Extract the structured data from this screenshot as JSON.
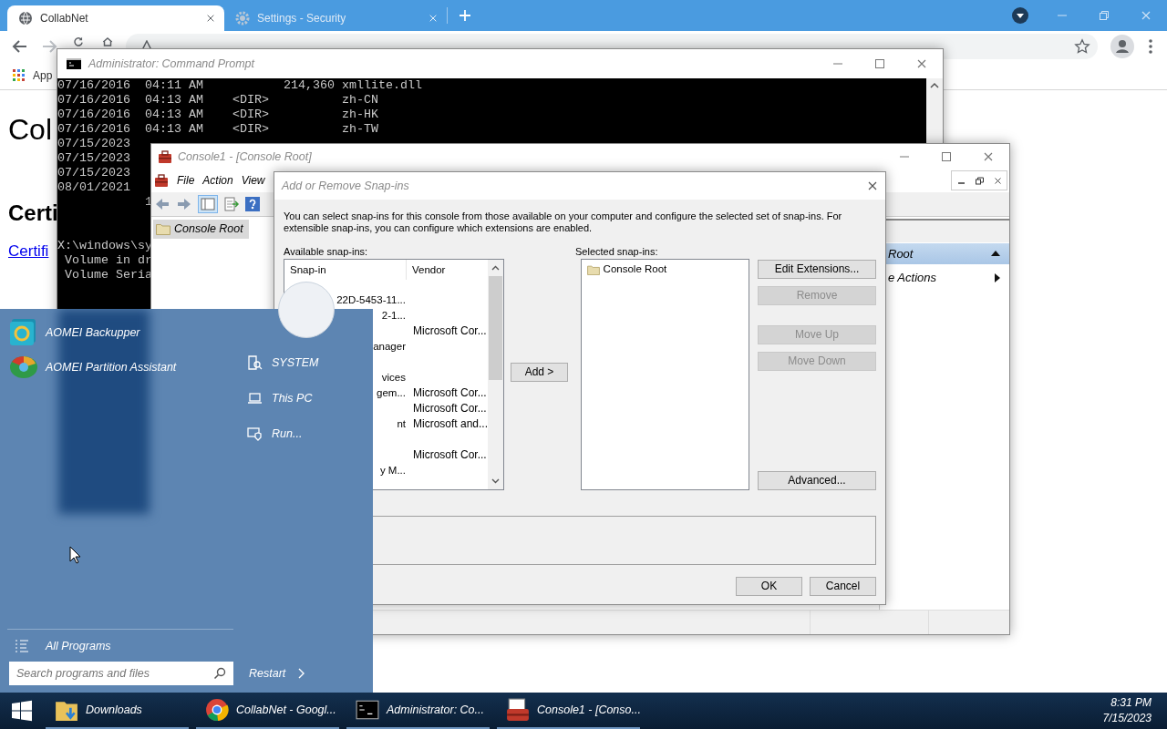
{
  "browser": {
    "tabs": [
      {
        "title": "CollabNet",
        "selected": true
      },
      {
        "title": "Settings - Security",
        "selected": false
      }
    ],
    "bookmarks": [
      "App"
    ],
    "page": {
      "heading": "Col",
      "subheading": "Certi",
      "link": "Certifi"
    }
  },
  "command_prompt": {
    "title": "Administrator: Command Prompt",
    "blocks": [
      [
        "07/16/2016  04:11 AM           214,360 xmllite.dll",
        "07/16/2016  04:13 AM    <DIR>          zh-CN",
        "07/16/2016  04:13 AM    <DIR>          zh-HK",
        "07/16/2016  04:13 AM    <DIR>          zh-TW",
        "07/15/2023",
        "07/15/2023",
        "07/15/2023",
        "08/01/2021",
        "            1"
      ],
      [
        "X:\\windows\\sy",
        " Volume in dr",
        " Volume Seria"
      ]
    ]
  },
  "console_window": {
    "title": "Console1 - [Console Root]",
    "menu": [
      "File",
      "Action",
      "View"
    ],
    "tree": [
      {
        "label": "Console Root",
        "selected": true
      }
    ],
    "actions": [
      {
        "label": "Root",
        "kind": "header"
      },
      {
        "label": "e Actions",
        "kind": "submenu"
      }
    ]
  },
  "snapin_dialog": {
    "title": "Add or Remove Snap-ins",
    "description": "You can select snap-ins for this console from those available on your computer and configure the selected set of snap-ins. For extensible snap-ins, you can configure which extensions are enabled.",
    "available_label": "Available snap-ins:",
    "columns": [
      "Snap-in",
      "Vendor"
    ],
    "rows": [
      {
        "snap_in": "22D-5453-11..."
      },
      {
        "snap_in": "2-1..."
      },
      {
        "vendor": "Microsoft Cor..."
      },
      {
        "snap_in": "anager"
      },
      {},
      {
        "snap_in": "vices"
      },
      {
        "snap_in": "gem...",
        "vendor": "Microsoft Cor..."
      },
      {
        "vendor": "Microsoft Cor..."
      },
      {
        "snap_in": "nt",
        "vendor": "Microsoft and..."
      },
      {},
      {
        "vendor": "Microsoft Cor..."
      },
      {
        "snap_in": "y M..."
      }
    ],
    "add_button": "Add >",
    "selected_label": "Selected snap-ins:",
    "selected_items": [
      "Console Root"
    ],
    "side_buttons": [
      {
        "label": "Edit Extensions...",
        "disabled": false
      },
      {
        "label": "Remove",
        "disabled": true
      },
      {
        "label": "Move Up",
        "disabled": true
      },
      {
        "label": "Move Down",
        "disabled": true
      }
    ],
    "advanced_button": {
      "label": "Advanced...",
      "disabled": false
    },
    "footer_buttons": [
      "OK",
      "Cancel"
    ]
  },
  "start_menu": {
    "pinned": [
      {
        "label": "AOMEI Backupper",
        "kind": "backup"
      },
      {
        "label": "AOMEI Partition Assistant",
        "kind": "partition"
      }
    ],
    "places": [
      {
        "label": "SYSTEM",
        "kind": "user"
      },
      {
        "label": "This PC",
        "kind": "computer"
      },
      {
        "label": "Run...",
        "kind": "run"
      }
    ],
    "all_programs": "All Programs",
    "search": {
      "placeholder": "Search programs and files"
    },
    "power": "Restart"
  },
  "taskbar": {
    "items": [
      {
        "label": "Downloads",
        "kind": "folder"
      },
      {
        "label": "CollabNet - Googl...",
        "kind": "chrome"
      },
      {
        "label": "Administrator: Co...",
        "kind": "cmd"
      },
      {
        "label": "Console1 - [Conso...",
        "kind": "mmc"
      }
    ],
    "clock": {
      "time": "8:31 PM",
      "date": "7/15/2023"
    }
  }
}
